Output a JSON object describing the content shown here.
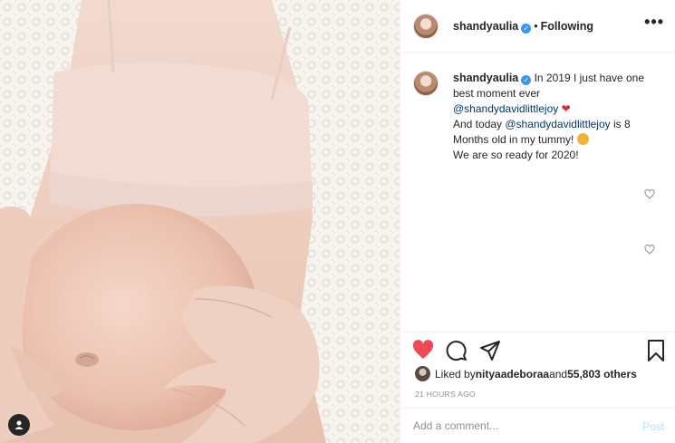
{
  "post": {
    "photo_alt": "",
    "tag_icon": "person-icon"
  },
  "header": {
    "username": "shandyaulia",
    "separator": "•",
    "follow_status": "Following",
    "more_label": "•••"
  },
  "caption": {
    "username": "shandyaulia",
    "line1_a": "In 2019 I just have one best moment ever",
    "mention1": "@shandydavidlittlejoy",
    "heart_emoji": "❤",
    "line2_a": "And today ",
    "mention2": "@shandydavidlittlejoy",
    "line2_b": " is 8 Months old in my tummy!",
    "line3": "We are so ready for 2020!"
  },
  "likes": {
    "prefix": "Liked by ",
    "user": "nityaadeboraa",
    "middle": " and ",
    "count": "55,803 others"
  },
  "timestamp": "21 HOURS AGO",
  "comment": {
    "placeholder": "Add a comment...",
    "post_label": "Post"
  },
  "colors": {
    "like_active": "#ed4956",
    "verified": "#3897f0",
    "post_disabled": "#b2dffc"
  }
}
